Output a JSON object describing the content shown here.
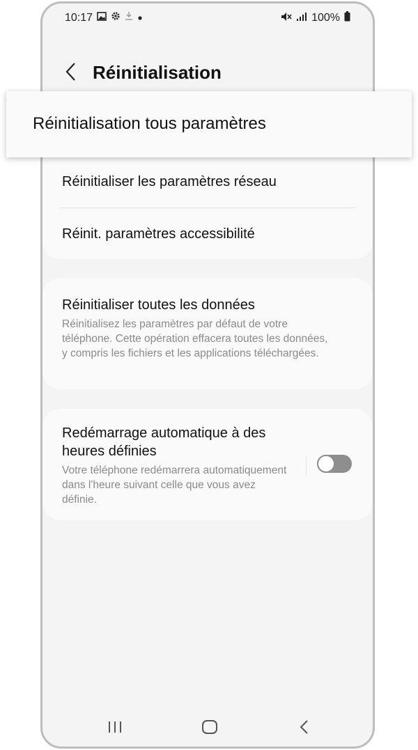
{
  "status_bar": {
    "time": "10:17",
    "battery": "100%",
    "left_icons": [
      "gallery-icon",
      "gear-icon",
      "download-icon",
      "dot-icon"
    ],
    "right_icons": [
      "mute-icon",
      "signal-icon",
      "battery-icon"
    ]
  },
  "header": {
    "title": "Réinitialisation"
  },
  "popup": {
    "label": "Réinitialisation tous paramètres"
  },
  "settings": {
    "network_reset": "Réinitialiser les paramètres réseau",
    "accessibility_reset": "Réinit. paramètres accessibilité",
    "factory_reset": {
      "title": "Réinitialiser toutes les données",
      "description": "Réinitialisez les paramètres par défaut de votre téléphone. Cette opération effacera toutes les données, y compris les fichiers et les applications téléchargées."
    },
    "auto_restart": {
      "title": "Redémarrage automatique à des heures définies",
      "description": "Votre téléphone redémarrera automatiquement dans l'heure suivant celle que vous avez définie.",
      "enabled": false
    }
  },
  "nav_bar": {
    "icons": [
      "recent-apps-icon",
      "home-icon",
      "back-icon"
    ]
  },
  "colors": {
    "background": "#f4f4f4",
    "card": "#fafafa",
    "toggle_off": "#8e8e8e"
  }
}
